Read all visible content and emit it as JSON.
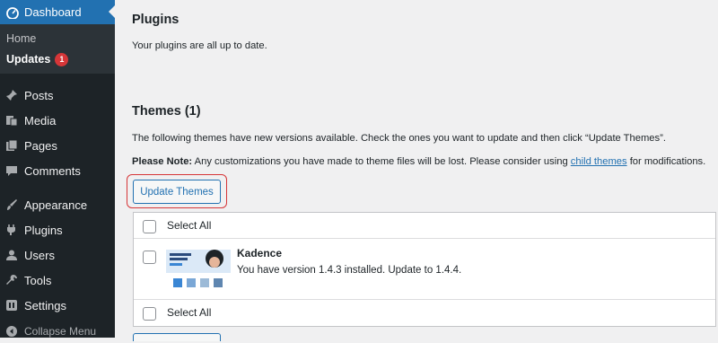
{
  "sidebar": {
    "dashboard": "Dashboard",
    "submenu": {
      "home": "Home",
      "updates": "Updates",
      "updates_count": "1"
    },
    "items": [
      {
        "label": "Posts",
        "icon": "pin-icon"
      },
      {
        "label": "Media",
        "icon": "media-icon"
      },
      {
        "label": "Pages",
        "icon": "pages-icon"
      },
      {
        "label": "Comments",
        "icon": "comment-icon"
      },
      {
        "label": "Appearance",
        "icon": "brush-icon"
      },
      {
        "label": "Plugins",
        "icon": "plug-icon"
      },
      {
        "label": "Users",
        "icon": "user-icon"
      },
      {
        "label": "Tools",
        "icon": "wrench-icon"
      },
      {
        "label": "Settings",
        "icon": "settings-icon"
      }
    ],
    "collapse": "Collapse Menu"
  },
  "main": {
    "plugins_title": "Plugins",
    "plugins_status": "Your plugins are all up to date.",
    "themes_title": "Themes (1)",
    "themes_info": "The following themes have new versions available. Check the ones you want to update and then click “Update Themes”.",
    "note_label": "Please Note:",
    "note_text": " Any customizations you have made to theme files will be lost. Please consider using ",
    "note_link": "child themes",
    "note_end": " for modifications.",
    "update_button": "Update Themes",
    "table": {
      "select_all_top": "Select All",
      "theme_name": "Kadence",
      "theme_desc": "You have version 1.4.3 installed. Update to 1.4.4.",
      "select_all_bottom": "Select All"
    }
  },
  "colors": {
    "accent": "#2271b1",
    "sidebar": "#1d2327",
    "badge": "#d63638",
    "highlight": "#d63638"
  }
}
